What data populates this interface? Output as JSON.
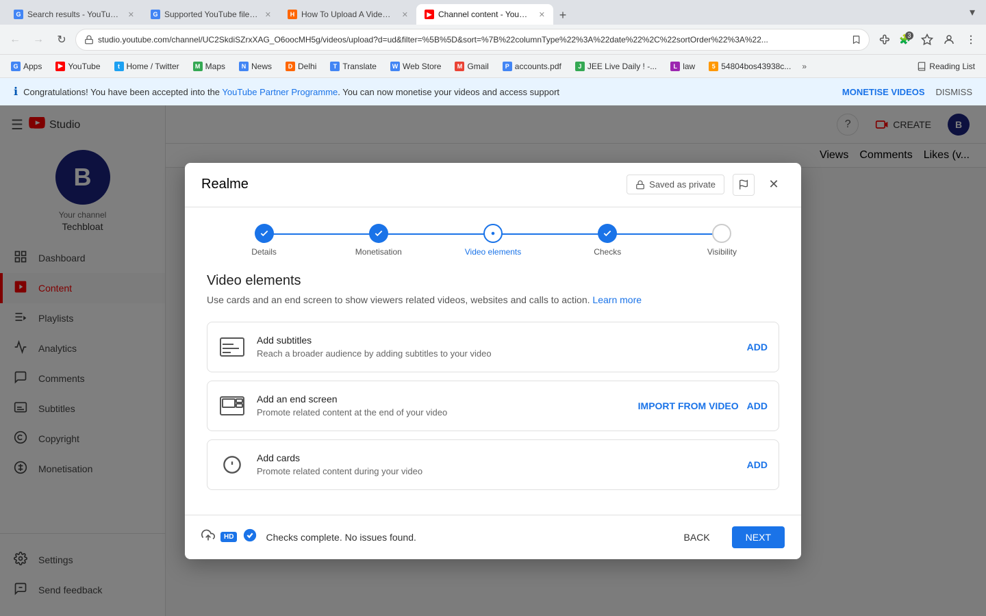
{
  "browser": {
    "tabs": [
      {
        "id": "tab1",
        "favicon_color": "#4285f4",
        "favicon_letter": "G",
        "title": "Search results - YouTube Help",
        "active": false
      },
      {
        "id": "tab2",
        "favicon_color": "#4285f4",
        "favicon_letter": "G",
        "title": "Supported YouTube file forma...",
        "active": false
      },
      {
        "id": "tab3",
        "favicon_color": "#ff6600",
        "favicon_letter": "H",
        "title": "How To Upload A Video To You...",
        "active": false
      },
      {
        "id": "tab4",
        "favicon_color": "#ff0000",
        "favicon_letter": "▶",
        "title": "Channel content - YouTube Stu...",
        "active": true
      }
    ],
    "address": "studio.youtube.com/channel/UC2SkdiSZrxXAG_O6oocMH5g/videos/upload?d=ud&filter=%5B%5D&sort=%7B%22columnType%22%3A%22date%22%2C%22sortOrder%22%3A%22...",
    "bookmarks": [
      {
        "id": "bk1",
        "label": "Apps",
        "favicon_color": "#4285f4",
        "favicon_letter": "G"
      },
      {
        "id": "bk2",
        "label": "YouTube",
        "favicon_color": "#ff0000",
        "favicon_letter": "▶"
      },
      {
        "id": "bk3",
        "label": "Home / Twitter",
        "favicon_color": "#1da1f2",
        "favicon_letter": "t"
      },
      {
        "id": "bk4",
        "label": "Maps",
        "favicon_color": "#34a853",
        "favicon_letter": "M"
      },
      {
        "id": "bk5",
        "label": "News",
        "favicon_color": "#4285f4",
        "favicon_letter": "N"
      },
      {
        "id": "bk6",
        "label": "Delhi",
        "favicon_color": "#ff6600",
        "favicon_letter": "D"
      },
      {
        "id": "bk7",
        "label": "Translate",
        "favicon_color": "#4285f4",
        "favicon_letter": "T"
      },
      {
        "id": "bk8",
        "label": "Web Store",
        "favicon_color": "#4285f4",
        "favicon_letter": "W"
      },
      {
        "id": "bk9",
        "label": "Gmail",
        "favicon_color": "#ea4335",
        "favicon_letter": "M"
      },
      {
        "id": "bk10",
        "label": "accounts.pdf",
        "favicon_color": "#4285f4",
        "favicon_letter": "P"
      },
      {
        "id": "bk11",
        "label": "JEE Live Daily ! -...",
        "favicon_color": "#34a853",
        "favicon_letter": "J"
      },
      {
        "id": "bk12",
        "label": "law",
        "favicon_color": "#9c27b0",
        "favicon_letter": "L"
      },
      {
        "id": "bk13",
        "label": "54804bos43938c...",
        "favicon_color": "#ff9800",
        "favicon_letter": "5"
      }
    ],
    "reading_list_label": "Reading List"
  },
  "notification_bar": {
    "message_prefix": "Congratulations! You have been accepted into the ",
    "link_text": "YouTube Partner Programme",
    "message_suffix": ". You can now monetise your videos and access support",
    "action_label": "MONETISE VIDEOS",
    "dismiss_label": "DISMISS"
  },
  "sidebar": {
    "hamburger_label": "Menu",
    "logo_text": "Studio",
    "channel": {
      "label": "Your channel",
      "name": "Techbloat",
      "avatar_letter": "B"
    },
    "nav_items": [
      {
        "id": "dashboard",
        "label": "Dashboard",
        "icon": "⊞"
      },
      {
        "id": "content",
        "label": "Content",
        "icon": "▶",
        "active": true
      },
      {
        "id": "playlists",
        "label": "Playlists",
        "icon": "☰"
      },
      {
        "id": "analytics",
        "label": "Analytics",
        "icon": "📊"
      },
      {
        "id": "comments",
        "label": "Comments",
        "icon": "💬"
      },
      {
        "id": "subtitles",
        "label": "Subtitles",
        "icon": "⬛"
      },
      {
        "id": "copyright",
        "label": "Copyright",
        "icon": "©"
      },
      {
        "id": "monetisation",
        "label": "Monetisation",
        "icon": "💰"
      }
    ],
    "bottom_items": [
      {
        "id": "settings",
        "label": "Settings",
        "icon": "⚙"
      },
      {
        "id": "send_feedback",
        "label": "Send feedback",
        "icon": "⚑"
      }
    ]
  },
  "content": {
    "table_columns": [
      "Views",
      "Comments",
      "Likes (v..."
    ]
  },
  "dialog": {
    "title": "Realme",
    "saved_badge": "Saved as private",
    "close_label": "Close",
    "stepper": {
      "steps": [
        {
          "id": "details",
          "label": "Details",
          "state": "done"
        },
        {
          "id": "monetisation",
          "label": "Monetisation",
          "state": "done"
        },
        {
          "id": "video_elements",
          "label": "Video elements",
          "state": "active"
        },
        {
          "id": "checks",
          "label": "Checks",
          "state": "done"
        },
        {
          "id": "visibility",
          "label": "Visibility",
          "state": "inactive"
        }
      ]
    },
    "section_title": "Video elements",
    "section_desc_prefix": "Use cards and an end screen to show viewers related videos, websites and calls to action. ",
    "learn_more_label": "Learn more",
    "elements": [
      {
        "id": "subtitles",
        "title": "Add subtitles",
        "desc": "Reach a broader audience by adding subtitles to your video",
        "actions": [
          "ADD"
        ]
      },
      {
        "id": "end_screen",
        "title": "Add an end screen",
        "desc": "Promote related content at the end of your video",
        "actions": [
          "IMPORT FROM VIDEO",
          "ADD"
        ]
      },
      {
        "id": "cards",
        "title": "Add cards",
        "desc": "Promote related content during your video",
        "actions": [
          "ADD"
        ]
      }
    ],
    "footer": {
      "status_text": "Checks complete. No issues found.",
      "back_label": "BACK",
      "next_label": "NEXT"
    }
  }
}
